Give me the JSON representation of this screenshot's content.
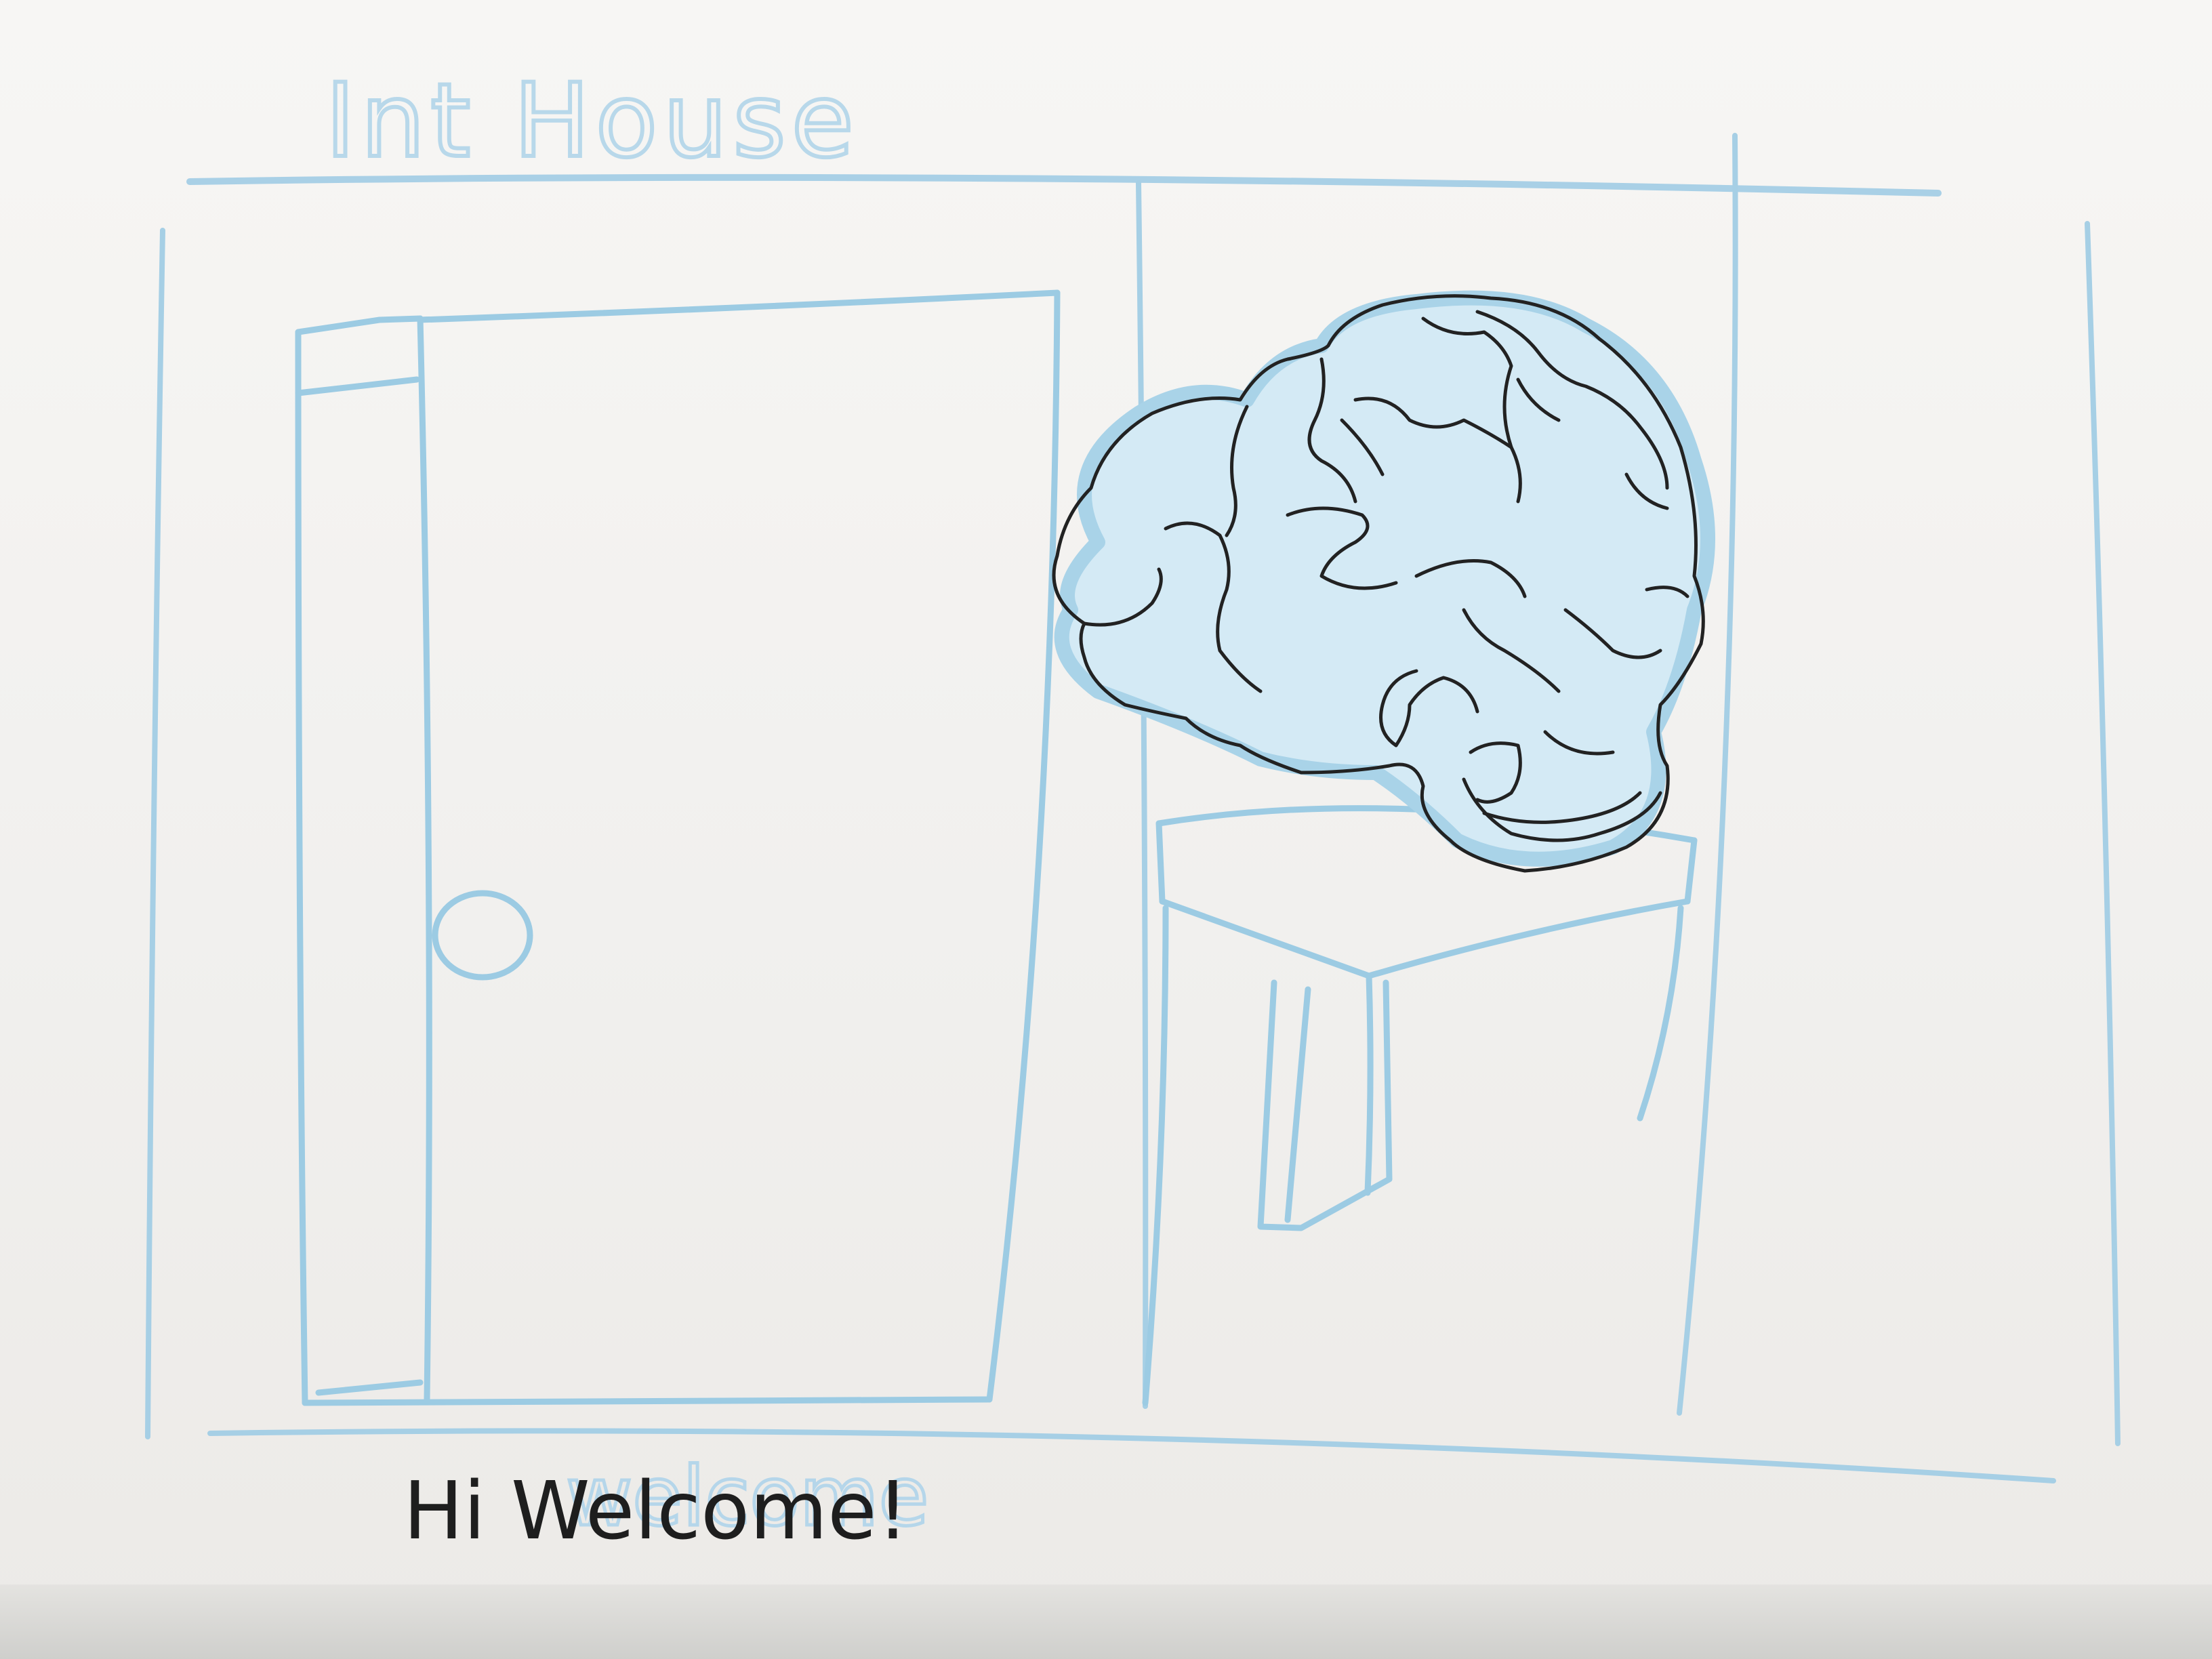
{
  "sketch": {
    "title": "Int House",
    "caption": "Hi Welcome!",
    "caption_ghost": "welcome",
    "colors": {
      "paper": "#f4f3f1",
      "pencil_blue": "#9ccbe3",
      "ink": "#1e1e1e",
      "brain_shade": "#cfe7f3"
    }
  }
}
